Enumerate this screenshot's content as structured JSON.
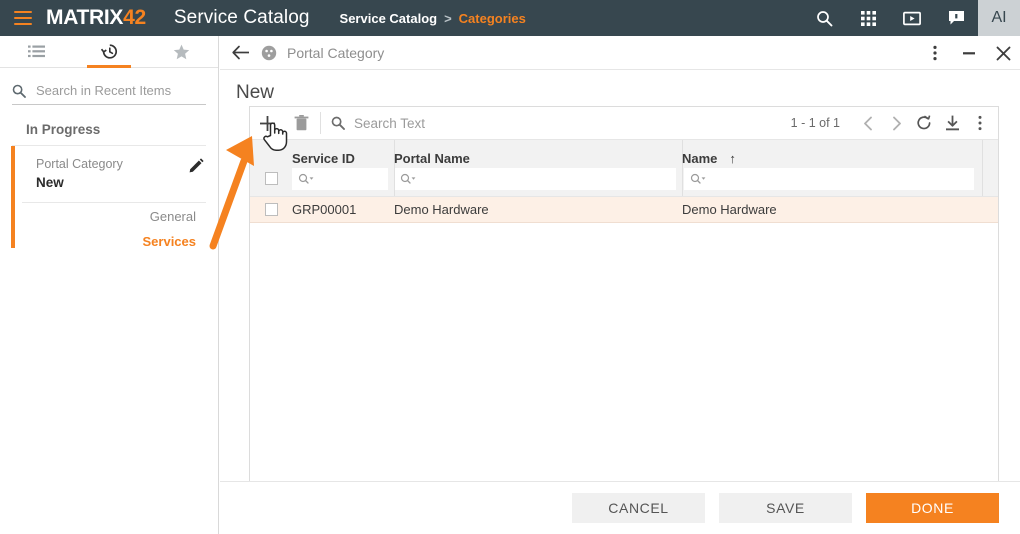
{
  "topbar": {
    "menu_icon": "hamburger-icon",
    "brand_white": "MATRIX",
    "brand_orange": "42",
    "app_title": "Service Catalog",
    "breadcrumb": {
      "root": "Service Catalog",
      "separator": ">",
      "current": "Categories"
    },
    "icons": [
      "search-icon",
      "apps-grid-icon",
      "video-icon",
      "chat-icon"
    ],
    "avatar_label": "AI",
    "bg_color": "#37474f",
    "accent_color": "#f58220"
  },
  "sidebar": {
    "tabs": [
      {
        "name": "list-icon",
        "active": false
      },
      {
        "name": "history-icon",
        "active": true
      },
      {
        "name": "favorites-star-icon",
        "active": false
      }
    ],
    "search": {
      "placeholder": "Search in Recent Items",
      "value": ""
    },
    "section_title": "In Progress",
    "recent_item": {
      "type": "Portal Category",
      "name": "New",
      "edit_icon": "pencil-icon"
    },
    "sub_items": [
      {
        "label": "General",
        "active": false
      },
      {
        "label": "Services",
        "active": true
      }
    ]
  },
  "dialog": {
    "header": {
      "back_icon": "back-arrow-icon",
      "object_icon": "portal-category-icon",
      "title": "Portal Category"
    },
    "window_controls": [
      "more-vertical-icon",
      "minimize-icon",
      "close-icon"
    ],
    "page_title": "New",
    "toolbar": {
      "add_icon": "plus-icon",
      "delete_icon": "trash-icon",
      "search_placeholder": "Search Text",
      "search_value": "",
      "page_info": "1 - 1 of 1",
      "prev_icon": "chevron-left-icon",
      "next_icon": "chevron-right-icon",
      "refresh_icon": "refresh-icon",
      "download_icon": "download-icon",
      "more_icon": "more-vertical-icon"
    },
    "table": {
      "columns": [
        {
          "label": "Service ID",
          "sorted": false
        },
        {
          "label": "Portal Name",
          "sorted": false
        },
        {
          "label": "Name",
          "sorted": true,
          "sort_direction": "ascending",
          "sort_glyph": "↑"
        }
      ],
      "filter_placeholder": "",
      "rows": [
        {
          "selected": false,
          "service_id": "GRP00001",
          "portal_name": "Demo Hardware",
          "name": "Demo Hardware"
        }
      ],
      "row_highlight_color": "#fdf0e6"
    },
    "footer": {
      "cancel_label": "CANCEL",
      "save_label": "SAVE",
      "done_label": "DONE",
      "done_color": "#f58220"
    }
  },
  "annotation": {
    "arrow_color": "#f58220",
    "points_to": "plus-icon"
  },
  "cursor": {
    "type": "pointing-hand-cursor"
  }
}
